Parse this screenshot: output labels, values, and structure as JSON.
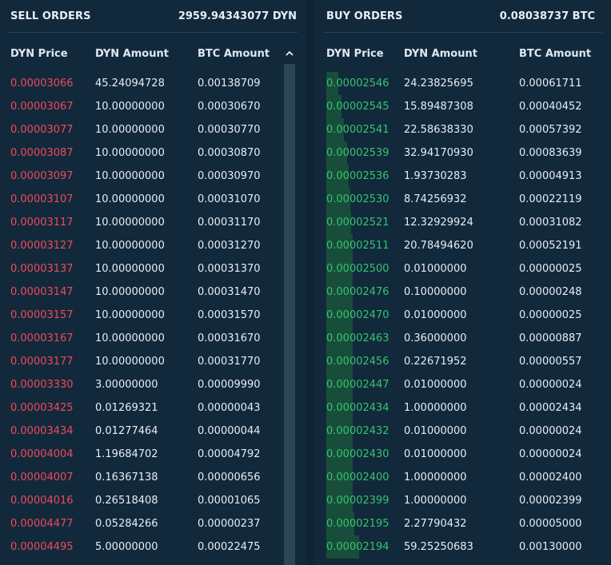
{
  "sell": {
    "title": "SELL ORDERS",
    "total": "2959.94343077 DYN",
    "columns": {
      "price": "DYN Price",
      "amount": "DYN Amount",
      "btc": "BTC Amount"
    },
    "scroll_icon": "chevron-up-icon",
    "price_color": "#ee4a5b",
    "rows": [
      {
        "price": "0.00003066",
        "amount": "45.24094728",
        "btc": "0.00138709"
      },
      {
        "price": "0.00003067",
        "amount": "10.00000000",
        "btc": "0.00030670"
      },
      {
        "price": "0.00003077",
        "amount": "10.00000000",
        "btc": "0.00030770"
      },
      {
        "price": "0.00003087",
        "amount": "10.00000000",
        "btc": "0.00030870"
      },
      {
        "price": "0.00003097",
        "amount": "10.00000000",
        "btc": "0.00030970"
      },
      {
        "price": "0.00003107",
        "amount": "10.00000000",
        "btc": "0.00031070"
      },
      {
        "price": "0.00003117",
        "amount": "10.00000000",
        "btc": "0.00031170"
      },
      {
        "price": "0.00003127",
        "amount": "10.00000000",
        "btc": "0.00031270"
      },
      {
        "price": "0.00003137",
        "amount": "10.00000000",
        "btc": "0.00031370"
      },
      {
        "price": "0.00003147",
        "amount": "10.00000000",
        "btc": "0.00031470"
      },
      {
        "price": "0.00003157",
        "amount": "10.00000000",
        "btc": "0.00031570"
      },
      {
        "price": "0.00003167",
        "amount": "10.00000000",
        "btc": "0.00031670"
      },
      {
        "price": "0.00003177",
        "amount": "10.00000000",
        "btc": "0.00031770"
      },
      {
        "price": "0.00003330",
        "amount": "3.00000000",
        "btc": "0.00009990"
      },
      {
        "price": "0.00003425",
        "amount": "0.01269321",
        "btc": "0.00000043"
      },
      {
        "price": "0.00003434",
        "amount": "0.01277464",
        "btc": "0.00000044"
      },
      {
        "price": "0.00004004",
        "amount": "1.19684702",
        "btc": "0.00004792"
      },
      {
        "price": "0.00004007",
        "amount": "0.16367138",
        "btc": "0.00000656"
      },
      {
        "price": "0.00004016",
        "amount": "0.26518408",
        "btc": "0.00001065"
      },
      {
        "price": "0.00004477",
        "amount": "0.05284266",
        "btc": "0.00000237"
      },
      {
        "price": "0.00004495",
        "amount": "5.00000000",
        "btc": "0.00022475"
      }
    ]
  },
  "buy": {
    "title": "BUY ORDERS",
    "total": "0.08038737 BTC",
    "columns": {
      "price": "DYN Price",
      "amount": "DYN Amount",
      "btc": "BTC Amount"
    },
    "price_color": "#35c46d",
    "rows": [
      {
        "price": "0.00002546",
        "amount": "24.23825695",
        "btc": "0.00061711",
        "depth": 0.04
      },
      {
        "price": "0.00002545",
        "amount": "15.89487308",
        "btc": "0.00040452",
        "depth": 0.05
      },
      {
        "price": "0.00002541",
        "amount": "22.58638330",
        "btc": "0.00057392",
        "depth": 0.06
      },
      {
        "price": "0.00002539",
        "amount": "32.94170930",
        "btc": "0.00083639",
        "depth": 0.07
      },
      {
        "price": "0.00002536",
        "amount": "1.93730283",
        "btc": "0.00004913",
        "depth": 0.075
      },
      {
        "price": "0.00002530",
        "amount": "8.74256932",
        "btc": "0.00022119",
        "depth": 0.08
      },
      {
        "price": "0.00002521",
        "amount": "12.32929924",
        "btc": "0.00031082",
        "depth": 0.085
      },
      {
        "price": "0.00002511",
        "amount": "20.78494620",
        "btc": "0.00052191",
        "depth": 0.09
      },
      {
        "price": "0.00002500",
        "amount": "0.01000000",
        "btc": "0.00000025",
        "depth": 0.09
      },
      {
        "price": "0.00002476",
        "amount": "0.10000000",
        "btc": "0.00000248",
        "depth": 0.09
      },
      {
        "price": "0.00002470",
        "amount": "0.01000000",
        "btc": "0.00000025",
        "depth": 0.09
      },
      {
        "price": "0.00002463",
        "amount": "0.36000000",
        "btc": "0.00000887",
        "depth": 0.09
      },
      {
        "price": "0.00002456",
        "amount": "0.22671952",
        "btc": "0.00000557",
        "depth": 0.09
      },
      {
        "price": "0.00002447",
        "amount": "0.01000000",
        "btc": "0.00000024",
        "depth": 0.09
      },
      {
        "price": "0.00002434",
        "amount": "1.00000000",
        "btc": "0.00002434",
        "depth": 0.09
      },
      {
        "price": "0.00002432",
        "amount": "0.01000000",
        "btc": "0.00000024",
        "depth": 0.09
      },
      {
        "price": "0.00002430",
        "amount": "0.01000000",
        "btc": "0.00000024",
        "depth": 0.09
      },
      {
        "price": "0.00002400",
        "amount": "1.00000000",
        "btc": "0.00002400",
        "depth": 0.09
      },
      {
        "price": "0.00002399",
        "amount": "1.00000000",
        "btc": "0.00002399",
        "depth": 0.09
      },
      {
        "price": "0.00002195",
        "amount": "2.27790432",
        "btc": "0.00005000",
        "depth": 0.095
      },
      {
        "price": "0.00002194",
        "amount": "59.25250683",
        "btc": "0.00130000",
        "depth": 0.11
      }
    ]
  }
}
